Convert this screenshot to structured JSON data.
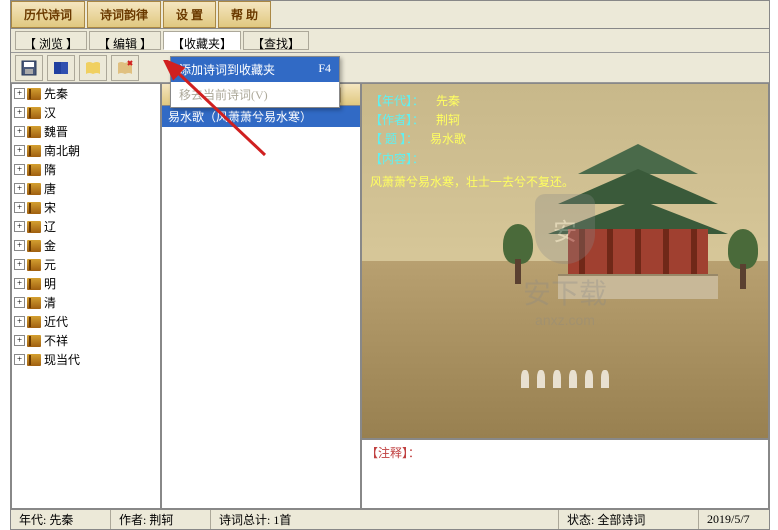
{
  "top_tabs": [
    "历代诗词",
    "诗词韵律",
    "设 置",
    "帮 助"
  ],
  "sub_tabs": [
    "【 浏览 】",
    "【 编辑 】",
    "【收藏夹】",
    "【查找】"
  ],
  "dropdown": {
    "item1_label": "添加诗词到收藏夹",
    "item1_shortcut": "F4",
    "item2_label": "移去当前诗词(V)"
  },
  "tree": [
    "先秦",
    "汉",
    "魏晋",
    "南北朝",
    "隋",
    "唐",
    "宋",
    "辽",
    "金",
    "元",
    "明",
    "清",
    "近代",
    "不祥",
    "现当代"
  ],
  "list": {
    "selected": "易水歌（风萧萧兮易水寒）"
  },
  "poem": {
    "era_label": "【年代】：",
    "era_value": "先秦",
    "author_label": "【作者】：",
    "author_value": "荆轲",
    "title_label": "【 题 】：",
    "title_value": "易水歌",
    "content_label": "【内容】：",
    "body": "风萧萧兮易水寒，壮士一去兮不复还。"
  },
  "notes": {
    "label": "【注释】："
  },
  "status": {
    "era": "年代: 先秦",
    "author": "作者: 荆轲",
    "count": "诗词总计: 1首",
    "state": "状态: 全部诗词",
    "date": "2019/5/7"
  },
  "watermark": {
    "main": "安下载",
    "sub": "anxz.com"
  }
}
